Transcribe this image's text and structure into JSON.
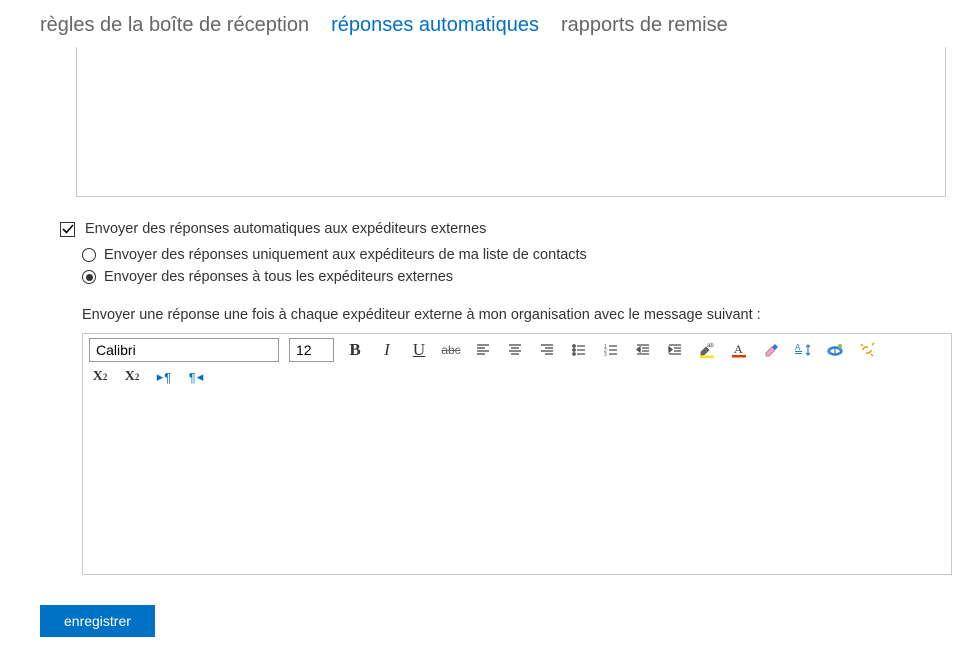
{
  "tabs": {
    "inbox_rules": "règles de la boîte de réception",
    "auto_replies": "réponses automatiques",
    "delivery_reports": "rapports de remise"
  },
  "checkbox": {
    "send_external": "Envoyer des réponses automatiques aux expéditeurs externes",
    "checked": true
  },
  "radios": {
    "contacts_only": "Envoyer des réponses uniquement aux expéditeurs de ma liste de contacts",
    "all_external": "Envoyer des réponses à tous les expéditeurs externes",
    "selected": "all_external"
  },
  "section_label": "Envoyer une réponse une fois à chaque expéditeur externe à mon organisation avec le message suivant :",
  "editor": {
    "font_name": "Calibri",
    "font_size": "12"
  },
  "toolbar": {
    "bold": "B",
    "italic": "I",
    "underline": "U",
    "strike": "abc"
  },
  "superscript": {
    "base": "X",
    "exp": "2"
  },
  "subscript": {
    "base": "X",
    "exp": "2"
  },
  "save_button": "enregistrer"
}
